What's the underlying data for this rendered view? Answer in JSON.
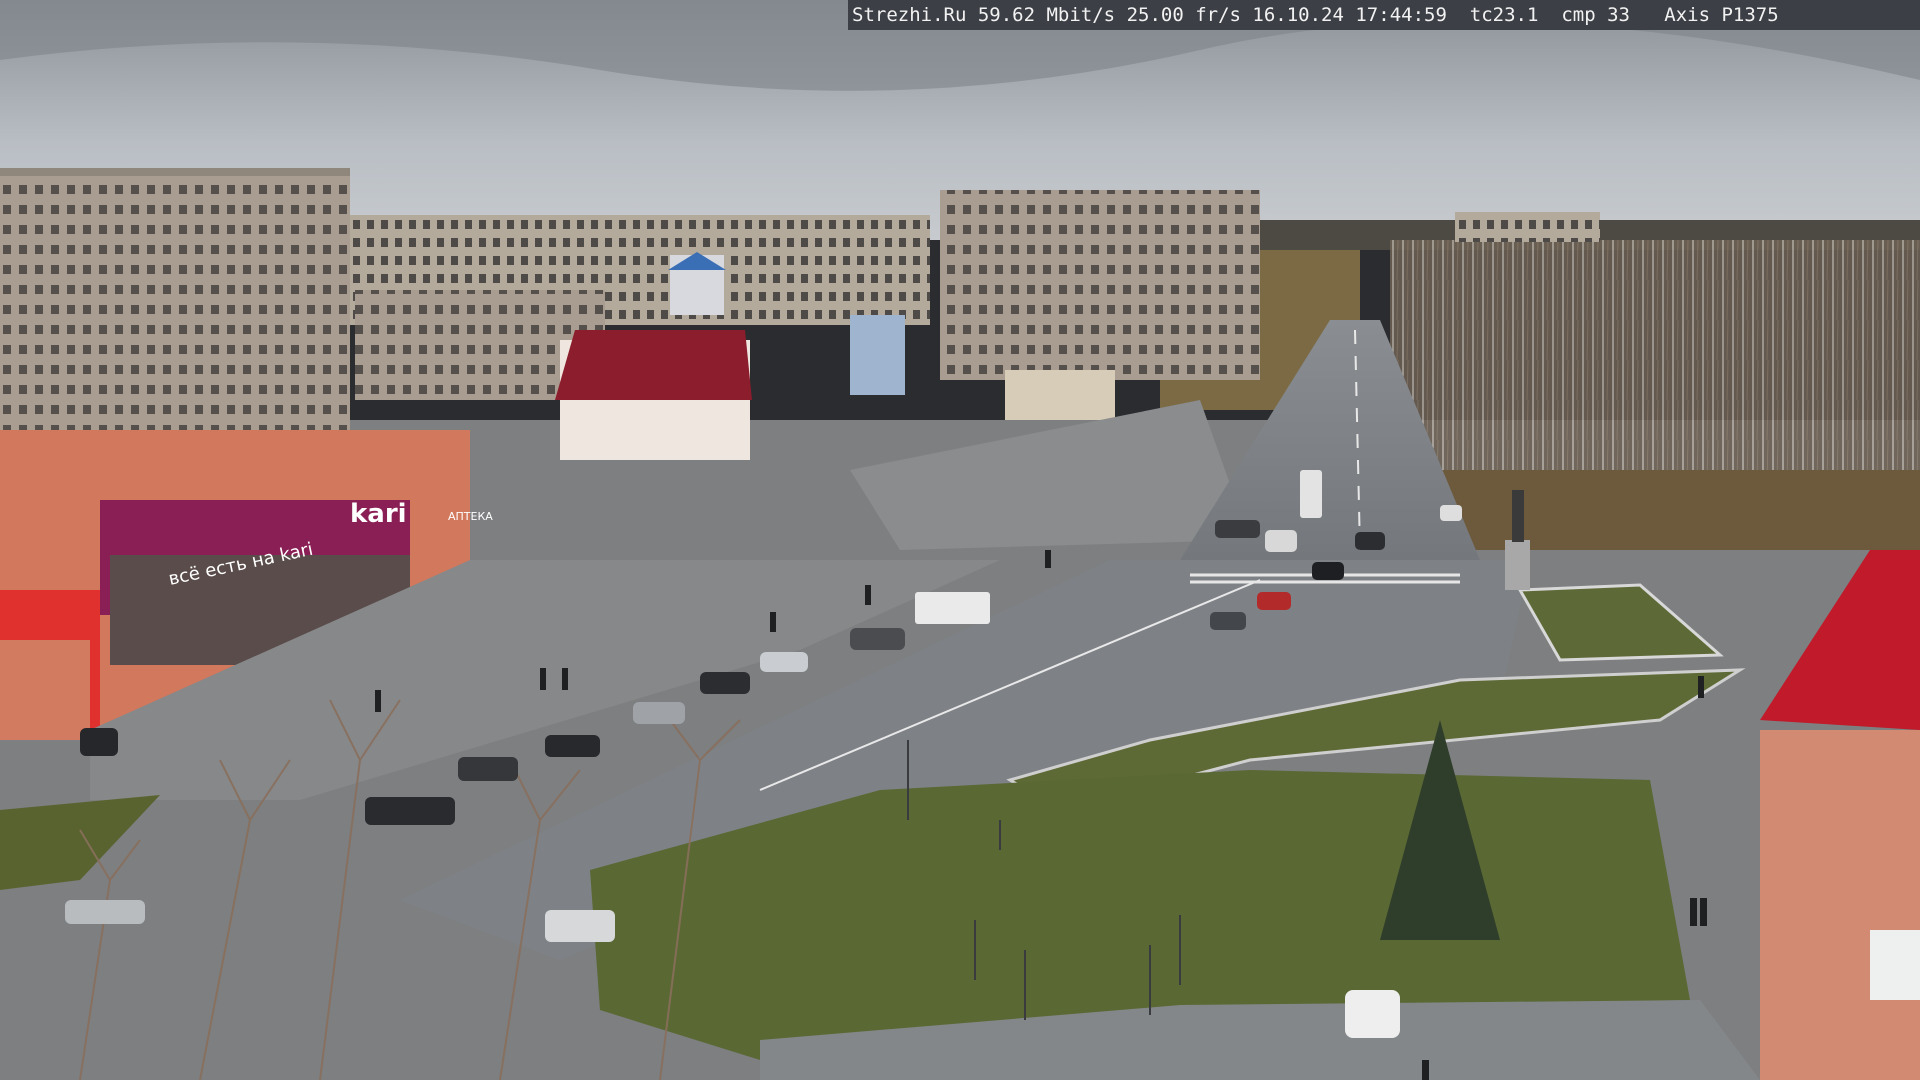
{
  "overlay": {
    "site": "Strezhi.Ru",
    "bitrate": "59.62 Mbit/s",
    "framerate": "25.00 fr/s",
    "datetime": "16.10.24 17:44:59",
    "tc": "tc23.1",
    "cmp": "cmp 33",
    "camera": "Axis P1375"
  },
  "signs": {
    "store_name": "kari",
    "store_slogan": "всё есть на kari",
    "pharmacy": "АПТЕКА"
  },
  "colors": {
    "sky": "#b9bec4",
    "storefront_band": "#8a1f55",
    "brick_building": "#d2785d",
    "red_roof": "#c11a2a",
    "road": "#7e8286",
    "grass": "#5d6a37"
  }
}
